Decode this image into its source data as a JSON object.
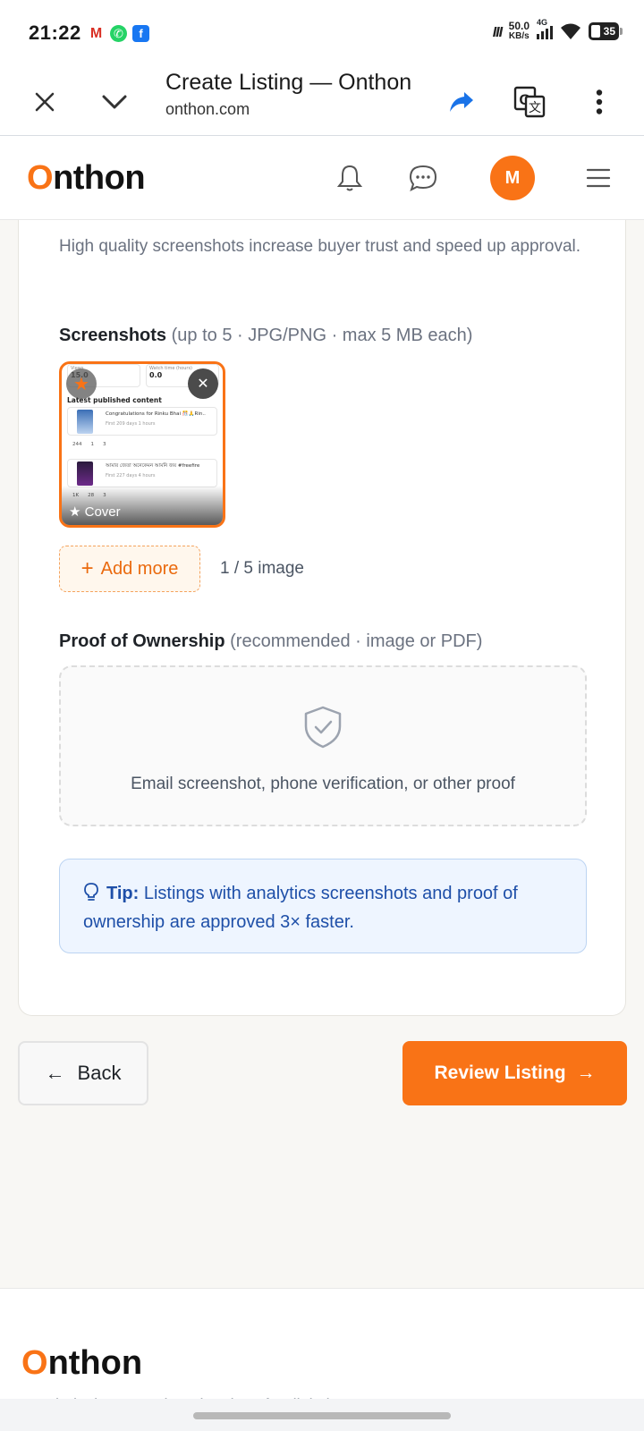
{
  "status_bar": {
    "time": "21:22",
    "net_logo": "ווו",
    "speed_value": "50.0",
    "speed_unit": "KB/s",
    "network_type": "4G",
    "battery": "35",
    "notification_icons": [
      "gmail-icon",
      "whatsapp-icon",
      "facebook-icon"
    ]
  },
  "browser": {
    "title": "Create Listing — Onthon",
    "url": "onthon.com",
    "icons": [
      "close-icon",
      "chevron-down-icon",
      "share-icon",
      "translate-icon",
      "more-vert-icon"
    ]
  },
  "header": {
    "logo_first": "O",
    "logo_rest": "nthon",
    "avatar_initial": "M",
    "icons": [
      "bell-icon",
      "chat-icon",
      "menu-icon"
    ]
  },
  "form": {
    "section_description": "High quality screenshots increase buyer trust and speed up approval.",
    "screenshots": {
      "label": "Screenshots",
      "hint": "(up to 5 · JPG/PNG · max 5 MB each)",
      "cover_label": "★ Cover",
      "star_glyph": "★",
      "remove_glyph": "✕",
      "add_more_label": "Add more",
      "add_more_glyph": "+",
      "count_text": "1 / 5 image",
      "thumbnail": {
        "stat1_label": "Views",
        "stat1_value": "15.0",
        "stat2_label": "Watch time (hours)",
        "stat2_value": "0.0",
        "heading": "Latest published content",
        "row1_title": "Congratulations for Rinku Bhai 🎊🙏Rin..",
        "row1_sub": "First 209 days 1 hours",
        "row1_stats": [
          "244",
          "1",
          "3"
        ],
        "row2_title": "আমার জেতা অনেকেমন আমনি জয় #freefire",
        "row2_sub": "First 227 days 4 hours",
        "row2_stats": [
          "1K",
          "28",
          "3"
        ]
      }
    },
    "proof": {
      "label": "Proof of Ownership",
      "hint": "(recommended · image or PDF)",
      "dropzone_text": "Email screenshot, phone verification, or other proof"
    },
    "tip": {
      "title": "Tip:",
      "text": " Listings with analytics screenshots and proof of ownership are approved 3× faster."
    }
  },
  "actions": {
    "back_label": "Back",
    "back_arrow": "←",
    "review_label": "Review Listing",
    "review_arrow": "→"
  },
  "footer": {
    "logo_first": "O",
    "logo_rest": "nthon",
    "cut_text": "Bangladesh's trusted marketplace for digital assets"
  },
  "colors": {
    "accent": "#f97316",
    "tip_bg": "#eef5ff",
    "tip_text": "#1e4fa8",
    "link_blue": "#1a73e8"
  }
}
